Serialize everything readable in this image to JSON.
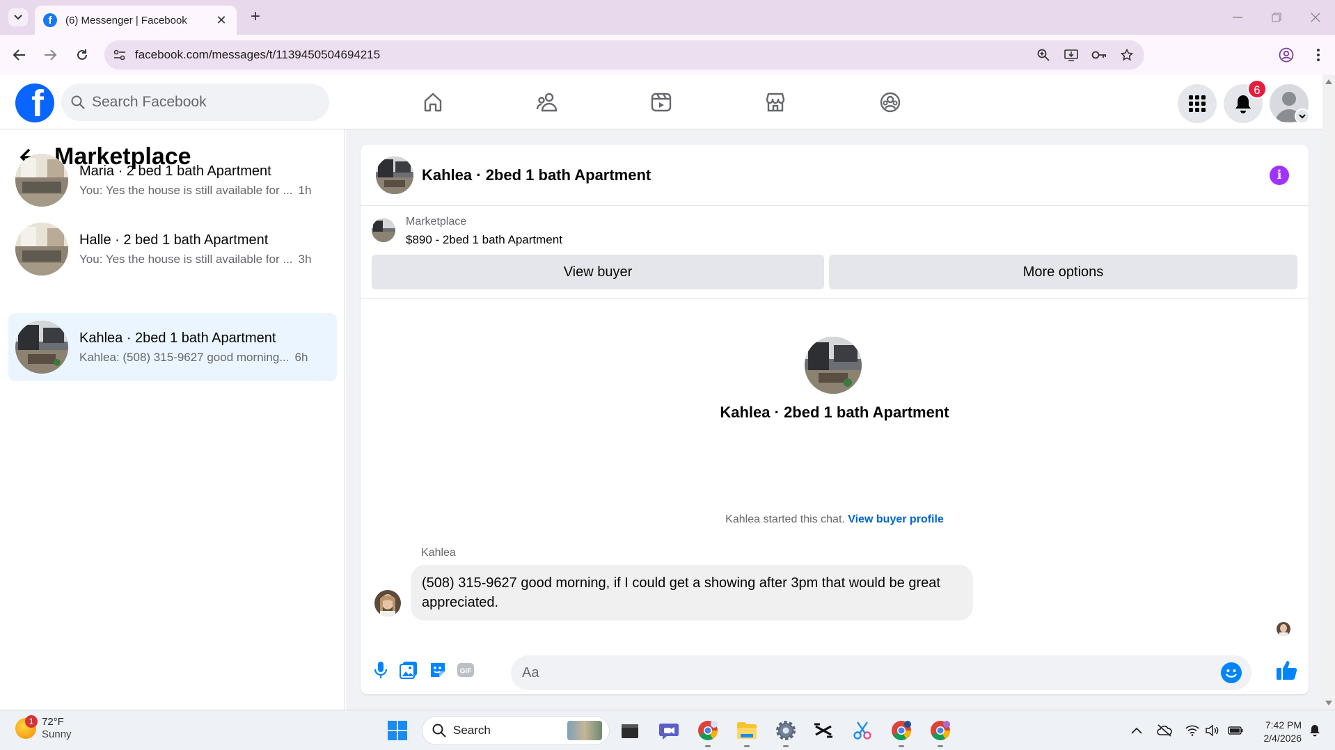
{
  "browser": {
    "tab_title": "(6) Messenger | Facebook",
    "url": "facebook.com/messages/t/1139450504694215"
  },
  "fb": {
    "search_placeholder": "Search Facebook",
    "notification_count": "6",
    "brand_color": "#0866ff"
  },
  "sidebar": {
    "title": "Marketplace",
    "conversations": [
      {
        "name": "Maria · 2 bed 1 bath Apartment",
        "snippet": "You: Yes the house is still available for ...",
        "time": "1h",
        "active": false
      },
      {
        "name": "Halle · 2 bed 1 bath Apartment",
        "snippet": "You: Yes the house is still available for ...",
        "time": "3h",
        "active": false
      },
      {
        "name": "Kahlea · 2bed 1 bath Apartment",
        "snippet": "Kahlea: (508) 315-9627 good morning...",
        "time": "6h",
        "active": true
      }
    ]
  },
  "chat": {
    "title": "Kahlea · 2bed 1 bath Apartment",
    "marketplace_label": "Marketplace",
    "listing": "$890 - 2bed 1 bath Apartment",
    "view_buyer_label": "View buyer",
    "more_options_label": "More options",
    "intro_name": "Kahlea · 2bed 1 bath Apartment",
    "started_text": "Kahlea started this chat.",
    "view_buyer_profile": "View buyer profile",
    "sender_name": "Kahlea",
    "message": "(508) 315-9627 good morning, if I could get a showing after 3pm that would be great appreciated.",
    "composer_placeholder": "Aa"
  },
  "taskbar": {
    "weather_temp": "72°F",
    "weather_cond": "Sunny",
    "weather_badge": "1",
    "search_label": "Search",
    "time": "7:42 PM",
    "date": "2/4/2026"
  }
}
